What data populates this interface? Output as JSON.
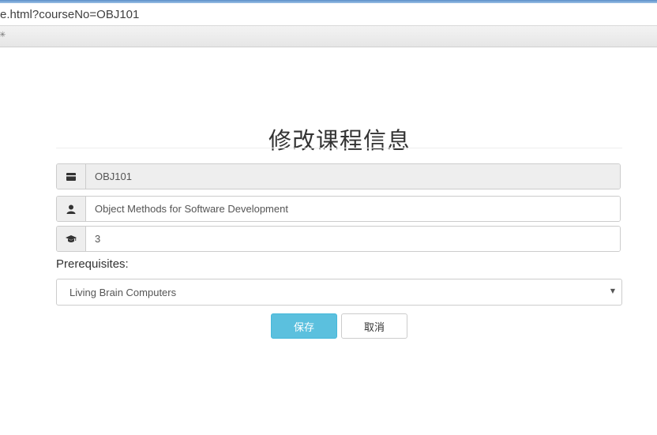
{
  "browser": {
    "address": "e.html?courseNo=OBJ101",
    "toolbar_glyph": "✳"
  },
  "page": {
    "title": "修改课程信息"
  },
  "form": {
    "course_no": {
      "value": "OBJ101",
      "icon": "card-icon",
      "readonly": true
    },
    "course_name": {
      "value": "Object Methods for Software Development",
      "icon": "user-icon"
    },
    "credits": {
      "value": "3",
      "icon": "graduation-cap-icon"
    },
    "prerequisites": {
      "label": "Prerequisites:",
      "selected": "Living Brain Computers"
    }
  },
  "actions": {
    "save_label": "保存",
    "cancel_label": "取消"
  },
  "colors": {
    "save_bg": "#5bc0de",
    "addon_bg": "#eeeeee",
    "border": "#cccccc"
  }
}
